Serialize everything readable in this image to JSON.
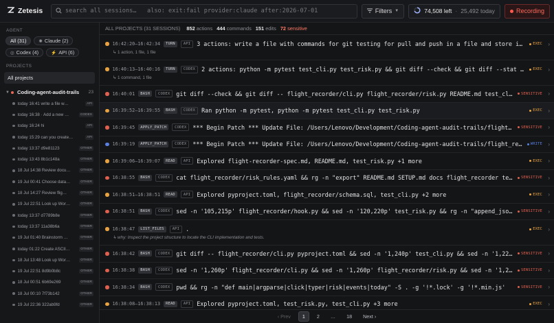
{
  "app": {
    "name": "Zetesis",
    "accent": "#ff5a4c"
  },
  "search": {
    "placeholder": "search all sessions…   also: exit:fail provider:claude after:2026-07-01"
  },
  "toolbar": {
    "filters_label": "Filters",
    "quota_left": "74,508 left",
    "quota_sep": "·",
    "quota_today": "25,492 today",
    "recording_label": "Recording"
  },
  "sidebar": {
    "agent_heading": "AGENT",
    "agent_chips": [
      {
        "label": "All (31)",
        "icon": ""
      },
      {
        "label": "Claude (2)",
        "icon": "✺"
      },
      {
        "label": "Codex (4)",
        "icon": "◎"
      },
      {
        "label": "API (6)",
        "icon": "⚡"
      }
    ],
    "projects_heading": "PROJECTS",
    "all_projects_label": "All projects",
    "project": {
      "name": "Coding-agent-audit-trails",
      "count": "23"
    },
    "sessions": [
      {
        "text": "today 16:41 write a file w…",
        "badge": "API"
      },
      {
        "text": "today 16:38 · Add a new …",
        "badge": "CODEX"
      },
      {
        "text": "today 16:24 hi",
        "badge": "API"
      },
      {
        "text": "today 15:29 can you create…",
        "badge": "API"
      },
      {
        "text": "today 13:37 d9e81123",
        "badge": "OTHER"
      },
      {
        "text": "today 13:43 8b1c148a",
        "badge": "OTHER"
      },
      {
        "text": "18 Jul 14:38 Review docu…",
        "badge": "OTHER"
      },
      {
        "text": "19 Jul 00:41 Choose data…",
        "badge": "OTHER"
      },
      {
        "text": "18 Jul 14:27 Review flig…",
        "badge": "OTHER"
      },
      {
        "text": "19 Jul 22:51 Look up Wor…",
        "badge": "OTHER"
      },
      {
        "text": "today 13:37 d7789b8e",
        "badge": "OTHER"
      },
      {
        "text": "today 13:37 11a38b6a",
        "badge": "OTHER"
      },
      {
        "text": "19 Jul 01:40 Brainstorm …",
        "badge": "OTHER"
      },
      {
        "text": "today 01:22 Create ASCII…",
        "badge": "OTHER"
      },
      {
        "text": "18 Jul 13:48 Look up Wor…",
        "badge": "OTHER"
      },
      {
        "text": "19 Jul 22:51 8d9b0b8c",
        "badge": "OTHER"
      },
      {
        "text": "18 Jul 00:51 6b69e269",
        "badge": "OTHER"
      },
      {
        "text": "18 Jul 00:10 7f73b142",
        "badge": "OTHER"
      },
      {
        "text": "19 Jul 22:36 322ab9fd",
        "badge": "OTHER"
      }
    ]
  },
  "stats": {
    "label": "ALL PROJECTS (31 SESSIONS)",
    "actions_value": "852",
    "actions_label": "actions",
    "commands_value": "444",
    "commands_label": "commands",
    "edits_value": "151",
    "edits_label": "edits",
    "sensitive_value": "72",
    "sensitive_label": "sensitive"
  },
  "colors": {
    "exec": "#e8a340",
    "sensitive": "#e0604f",
    "write": "#5b7fe0"
  },
  "events": [
    {
      "time": "16:42:20–16:42:34",
      "kind": "TURN",
      "prov": "API",
      "text": "3 actions: write a file with commands for git testing for pull and push in a file and store it, git_…",
      "status": "EXEC",
      "sub": "↳ 1 action, 1 file, 1 file",
      "subtype": "info",
      "hl": false
    },
    {
      "time": "16:40:13–16:40:16",
      "kind": "TURN",
      "prov": "CODEX",
      "text": "2 actions: python -m pytest test_cli.py test_risk.py && git diff --check && git diff --stat && sed …",
      "status": "EXEC",
      "sub": "↳ 1 command, 1 file",
      "subtype": "info",
      "hl": false
    },
    {
      "time": "16:40:01",
      "kind": "BASH",
      "prov": "CODEX",
      "text": "git diff --check && git diff -- flight_recorder/cli.py flight_recorder/risk.py README.md test_cli.py test_…",
      "status": "SENSITIVE",
      "sub": "",
      "subtype": "",
      "hl": false
    },
    {
      "time": "16:39:52–16:39:55",
      "kind": "BASH",
      "prov": "CODEX",
      "text": "Ran python -m pytest, python -m pytest test_cli.py test_risk.py",
      "status": "EXEC",
      "sub": "",
      "subtype": "",
      "hl": true
    },
    {
      "time": "16:39:45",
      "kind": "APPLY_PATCH",
      "prov": "CODEX",
      "text": "*** Begin Patch *** Update File: /Users/Lenovo/Development/Coding-agent-audit-trails/flight_recorder…",
      "status": "SENSITIVE",
      "sub": "",
      "subtype": "",
      "hl": false
    },
    {
      "time": "16:39:19",
      "kind": "APPLY_PATCH",
      "prov": "CODEX",
      "text": "*** Begin Patch *** Update File: /Users/Lenovo/Development/Coding-agent-audit-trails/flight_recorder…",
      "status": "WRITE",
      "sub": "",
      "subtype": "",
      "hl": false
    },
    {
      "time": "16:39:06–16:39:07",
      "kind": "READ",
      "prov": "API",
      "text": "Explored flight-recorder-spec.md, README.md, test_risk.py +1 more",
      "status": "EXEC",
      "sub": "",
      "subtype": "",
      "hl": false
    },
    {
      "time": "16:38:55",
      "kind": "BASH",
      "prov": "CODEX",
      "text": "cat flight_recorder/risk_rules.yaml && rg -n \"export\" README.md SETUP.md docs flight_recorder test_*.py -…",
      "status": "SENSITIVE",
      "sub": "",
      "subtype": "",
      "hl": false
    },
    {
      "time": "16:38:51–16:38:51",
      "kind": "READ",
      "prov": "API",
      "text": "Explored pyproject.toml, flight_recorder/schema.sql, test_cli.py +2 more",
      "status": "EXEC",
      "sub": "",
      "subtype": "",
      "hl": false
    },
    {
      "time": "16:38:51",
      "kind": "BASH",
      "prov": "CODEX",
      "text": "sed -n '105,215p' flight_recorder/hook.py && sed -n '120,220p' test_risk.py && rg -n \"append_jsonl|commit…",
      "status": "SENSITIVE",
      "sub": "",
      "subtype": "",
      "hl": false
    },
    {
      "time": "16:38:47",
      "kind": "LIST_FILES",
      "prov": "API",
      "text": ".",
      "status": "EXEC",
      "sub": "↳ why: Inspect the project structure to locate the CLI implementation and tests.",
      "subtype": "why",
      "hl": false
    },
    {
      "time": "16:38:42",
      "kind": "BASH",
      "prov": "CODEX",
      "text": "git diff -- flight_recorder/cli.py pyproject.toml && sed -n '1,240p' test_cli.py && sed -n '1,220p' test_…",
      "status": "SENSITIVE",
      "sub": "",
      "subtype": "",
      "hl": false
    },
    {
      "time": "16:38:38",
      "kind": "BASH",
      "prov": "CODEX",
      "text": "sed -n '1,260p' flight_recorder/cli.py && sed -n '1,260p' flight_recorder/risk.py && sed -n '1,250p' fligh…",
      "status": "SENSITIVE",
      "sub": "",
      "subtype": "",
      "hl": false
    },
    {
      "time": "16:38:34",
      "kind": "BASH",
      "prov": "CODEX",
      "text": "pwd && rg -n \"def main|argparse|click|typer|risk|events|today\" -S . -g '!*.lock' -g '!*.min.js'",
      "status": "SENSITIVE",
      "sub": "",
      "subtype": "",
      "hl": false
    },
    {
      "time": "16:38:08–16:38:13",
      "kind": "READ",
      "prov": "API",
      "text": "Explored pyproject.toml, test_risk.py, test_cli.py +3 more",
      "status": "EXEC",
      "sub": "",
      "subtype": "",
      "hl": false
    }
  ],
  "pager": {
    "prev": "‹ Prev",
    "pages": [
      "1",
      "2",
      "…",
      "18"
    ],
    "next": "Next ›",
    "current": "1"
  }
}
